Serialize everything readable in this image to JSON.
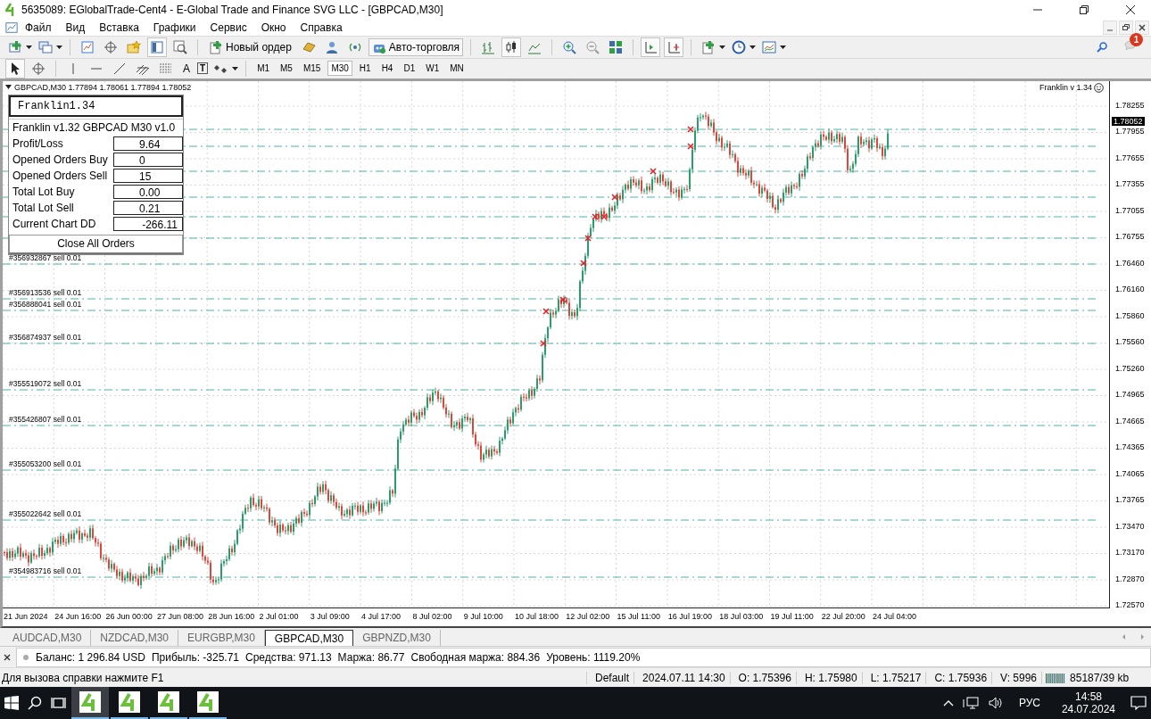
{
  "window": {
    "title": "5635089: EGlobalTrade-Cent4 - E-Global Trade and Finance SVG LLC - [GBPCAD,M30]"
  },
  "menu": [
    "Файл",
    "Вид",
    "Вставка",
    "Графики",
    "Сервис",
    "Окно",
    "Справка"
  ],
  "toolbar": {
    "new_order": "Новый ордер",
    "auto_trading": {
      "label": "Авто-торговля",
      "on": true
    },
    "notifications_badge": "1"
  },
  "drawing_tools": {
    "text_label": "A",
    "text_box_label": "T"
  },
  "timeframes": [
    {
      "label": "M1",
      "selected": false
    },
    {
      "label": "M5",
      "selected": false
    },
    {
      "label": "M15",
      "selected": false
    },
    {
      "label": "M30",
      "selected": true
    },
    {
      "label": "H1",
      "selected": false
    },
    {
      "label": "H4",
      "selected": false
    },
    {
      "label": "D1",
      "selected": false
    },
    {
      "label": "W1",
      "selected": false
    },
    {
      "label": "MN",
      "selected": false
    }
  ],
  "chart": {
    "header": "GBPCAD,M30  1.77894 1.78061 1.77894 1.78052",
    "expert_label": "Franklin v 1.34",
    "current_price": "1.78052",
    "price_axis": [
      "1.78255",
      "1.77955",
      "1.77655",
      "1.77355",
      "1.77055",
      "1.76755",
      "1.76460",
      "1.76160",
      "1.75860",
      "1.75560",
      "1.75260",
      "1.74965",
      "1.74665",
      "1.74365",
      "1.74065",
      "1.73765",
      "1.73470",
      "1.73170",
      "1.72870",
      "1.72570"
    ],
    "time_axis": [
      "21 Jun 2024",
      "24 Jun 16:00",
      "26 Jun 00:00",
      "27 Jun 08:00",
      "28 Jun 16:00",
      "2 Jul 01:00",
      "3 Jul 09:00",
      "4 Jul 17:00",
      "8 Jul 02:00",
      "9 Jul 10:00",
      "10 Jul 18:00",
      "12 Jul 02:00",
      "15 Jul 11:00",
      "16 Jul 19:00",
      "18 Jul 03:00",
      "19 Jul 11:00",
      "22 Jul 20:00",
      "24 Jul 04:00"
    ],
    "order_labels": [
      "#356932867 sell 0.01",
      "#356913536 sell 0.01",
      "#356888041 sell 0.01",
      "#356874937 sell 0.01",
      "#355519072 sell 0.01",
      "#355426807 sell 0.01",
      "#355053200 sell 0.01",
      "#355022642 sell 0.01",
      "#354983716 sell 0.01"
    ]
  },
  "panel": {
    "title": "Franklin1.34",
    "subtitle": "Franklin v1.32 GBPCAD M30 v1.0",
    "rows": [
      {
        "label": "Profit/Loss",
        "value": "9.64"
      },
      {
        "label": "Opened Orders Buy",
        "value": "0"
      },
      {
        "label": "Opened Orders Sell",
        "value": "15"
      },
      {
        "label": "Total Lot Buy",
        "value": "0.00"
      },
      {
        "label": "Total Lot Sell",
        "value": "0.21"
      },
      {
        "label": "Current Chart DD",
        "value": "-266.11"
      }
    ],
    "button": "Close All Orders"
  },
  "chart_tabs": [
    {
      "label": "AUDCAD,M30",
      "selected": false
    },
    {
      "label": "NZDCAD,M30",
      "selected": false
    },
    {
      "label": "EURGBP,M30",
      "selected": false
    },
    {
      "label": "GBPCAD,M30",
      "selected": true
    },
    {
      "label": "GBPNZD,M30",
      "selected": false
    }
  ],
  "terminal": {
    "summary": [
      "Баланс: 1 296.84 USD",
      "Прибыль: -325.71",
      "Средства: 971.13",
      "Маржа: 86.77",
      "Свободная маржа: 884.36",
      "Уровень: 1119.20%"
    ]
  },
  "status_bar": {
    "help": "Для вызова справки нажмите F1",
    "profile": "Default",
    "bar_time": "2024.07.11 14:30",
    "open": "O: 1.75396",
    "high": "H: 1.75980",
    "low": "L: 1.75217",
    "close": "C: 1.75936",
    "volume": "V: 5996",
    "traffic": "85187/39 kb"
  },
  "taskbar": {
    "apps": [
      {
        "selected": true
      },
      {
        "selected": false
      },
      {
        "selected": false
      },
      {
        "selected": false
      }
    ],
    "language": "РУС",
    "time": "14:58",
    "date": "24.07.2024"
  }
}
